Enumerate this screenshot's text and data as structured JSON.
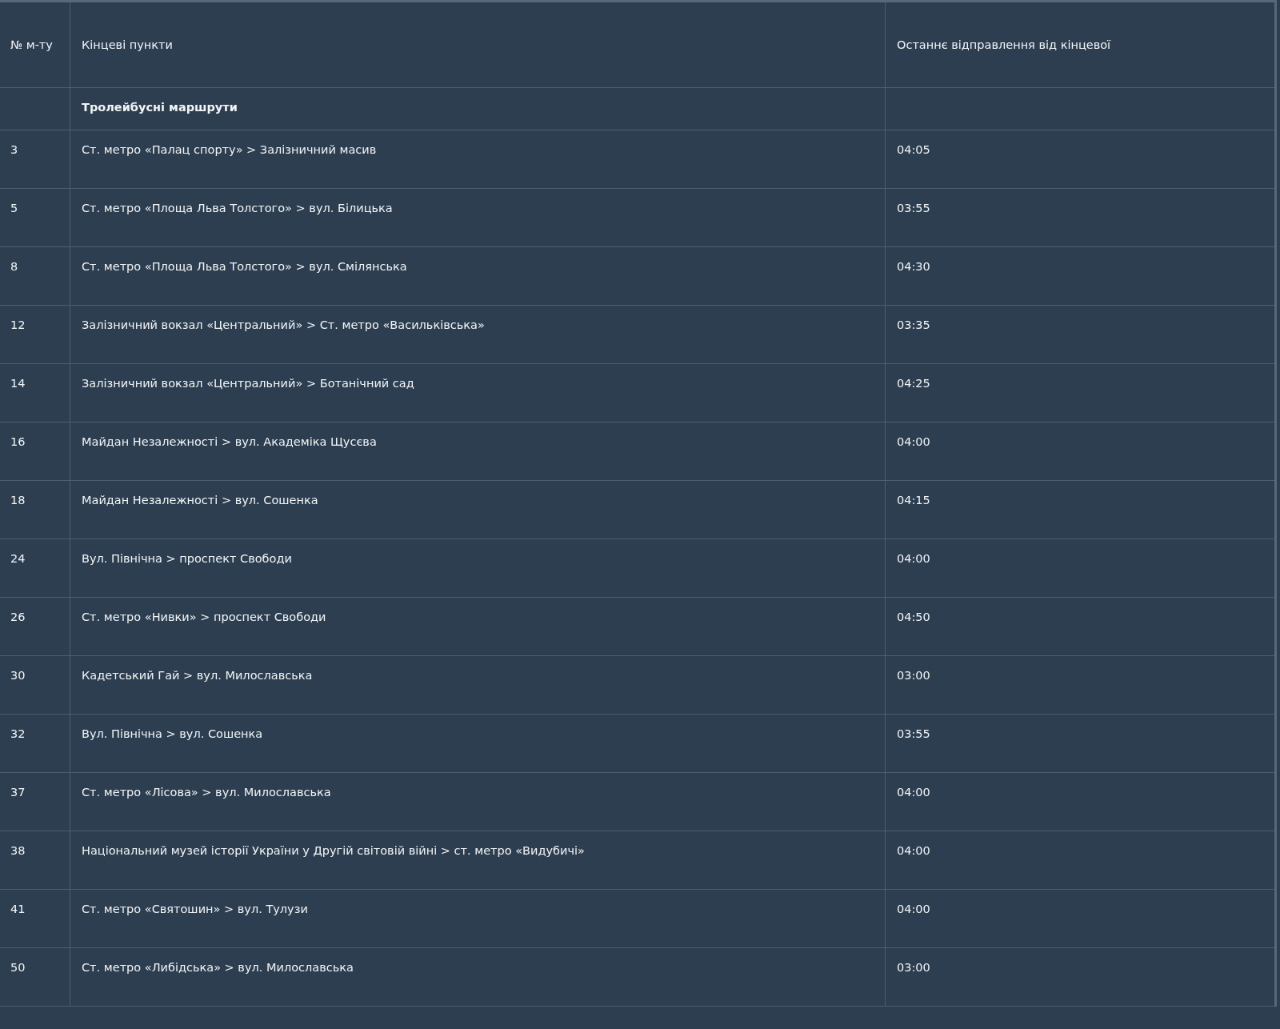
{
  "table": {
    "columns": [
      "№ м-ту",
      "Кінцеві пункти",
      "Останнє відправлення від кінцевої"
    ],
    "groups": [
      {
        "title": "Тролейбусні маршрути",
        "rows": [
          {
            "number": "3",
            "endpoints": "Ст. метро «Палац спорту» > Залізничний масив",
            "last_departure": "04:05"
          },
          {
            "number": "5",
            "endpoints": "Ст. метро «Площа Льва Толстого» > вул. Білицька",
            "last_departure": "03:55"
          },
          {
            "number": "8",
            "endpoints": "Ст. метро «Площа Льва Толстого» > вул. Смілянська",
            "last_departure": "04:30"
          },
          {
            "number": "12",
            "endpoints": "Залізничний вокзал «Центральний» > Ст. метро «Васильківська»",
            "last_departure": "03:35"
          },
          {
            "number": "14",
            "endpoints": "Залізничний вокзал «Центральний» > Ботанічний сад",
            "last_departure": "04:25"
          },
          {
            "number": "16",
            "endpoints": "Майдан Незалежності > вул. Академіка Щусєва",
            "last_departure": "04:00"
          },
          {
            "number": "18",
            "endpoints": "Майдан Незалежності > вул. Сошенка",
            "last_departure": "04:15"
          },
          {
            "number": "24",
            "endpoints": "Вул. Північна > проспект Свободи",
            "last_departure": "04:00"
          },
          {
            "number": "26",
            "endpoints": "Ст. метро «Нивки» > проспект Свободи",
            "last_departure": "04:50"
          },
          {
            "number": "30",
            "endpoints": "Кадетський Гай > вул. Милославська",
            "last_departure": "03:00"
          },
          {
            "number": "32",
            "endpoints": "Вул. Північна > вул. Сошенка",
            "last_departure": "03:55"
          },
          {
            "number": "37",
            "endpoints": "Ст. метро «Лісова» > вул. Милославська",
            "last_departure": "04:00"
          },
          {
            "number": "38",
            "endpoints": "Національний музей історії України у Другій світовій війні > ст. метро «Видубичі»",
            "last_departure": "04:00"
          },
          {
            "number": "41",
            "endpoints": "Ст. метро «Святошин» > вул. Тулузи",
            "last_departure": "04:00"
          },
          {
            "number": "50",
            "endpoints": "Ст. метро «Либідська» > вул. Милославська",
            "last_departure": "03:00"
          }
        ]
      }
    ]
  }
}
